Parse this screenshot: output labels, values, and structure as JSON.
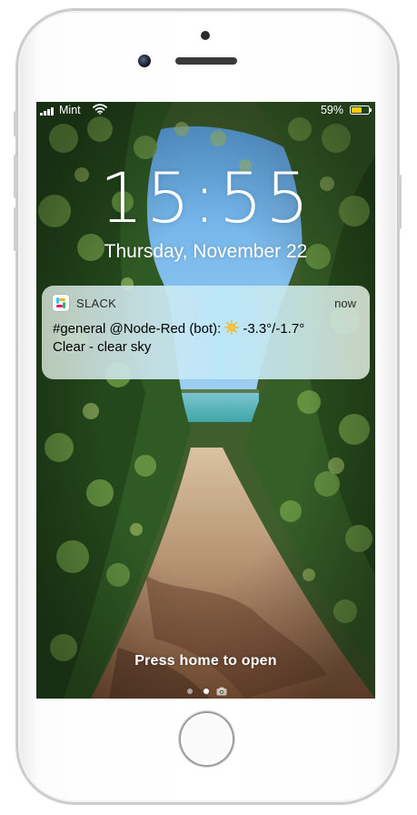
{
  "status_bar": {
    "carrier": "Mint",
    "signal_bars": 4,
    "wifi_icon": "wifi-icon",
    "battery_percent_text": "59%",
    "battery_level": 0.59,
    "battery_color": "#ffcc00"
  },
  "lock_screen": {
    "time": "15:55",
    "date": "Thursday, November 22"
  },
  "notification": {
    "app_name": "SLACK",
    "app_icon": "slack-icon",
    "time": "now",
    "line1_prefix": "#general @Node-Red (bot):",
    "weather_icon": "sun-icon",
    "line1_suffix": "-3.3°/-1.7°",
    "line2": "Clear - clear sky"
  },
  "bottom": {
    "hint": "Press home to open",
    "pages": [
      "dot-inactive",
      "dot-active",
      "camera-icon"
    ]
  },
  "colors": {
    "slack_green": "#2eb67d",
    "slack_pink": "#e01e5a",
    "slack_yellow": "#ecb22e",
    "slack_blue": "#36c5f0"
  }
}
